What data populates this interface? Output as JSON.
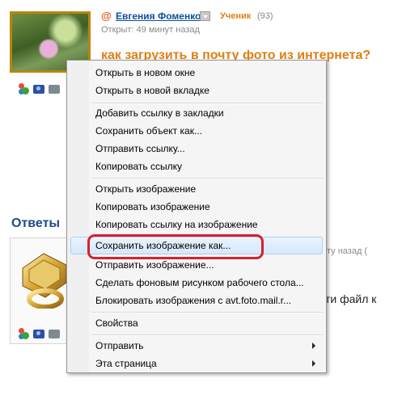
{
  "question": {
    "author": "Евгения Фоменко",
    "rank": "Ученик",
    "rank_count": "(93)",
    "opened": "Открыт: 49 минут назад",
    "title": "как загрузить в почту фото из интернета?",
    "at_symbol": "@"
  },
  "answers": {
    "heading": "Ответы",
    "meta": "ту назад  (",
    "text": "ти файл к"
  },
  "context_menu": {
    "items": [
      "Открыть в новом окне",
      "Открыть в новой вкладке",
      "Добавить ссылку в закладки",
      "Сохранить объект как...",
      "Отправить ссылку...",
      "Копировать ссылку",
      "Открыть изображение",
      "Копировать изображение",
      "Копировать ссылку на изображение",
      "Сохранить изображение как...",
      "Отправить изображение...",
      "Сделать фоновым рисунком рабочего стола...",
      "Блокировать изображения с avt.foto.mail.r...",
      "Свойства",
      "Отправить",
      "Эта страница"
    ],
    "highlighted_item": "Сохранить изображение как..."
  },
  "colors": {
    "accent_orange": "#e07f12",
    "link_blue": "#0d4f9c",
    "highlight_red": "#d9202a"
  }
}
